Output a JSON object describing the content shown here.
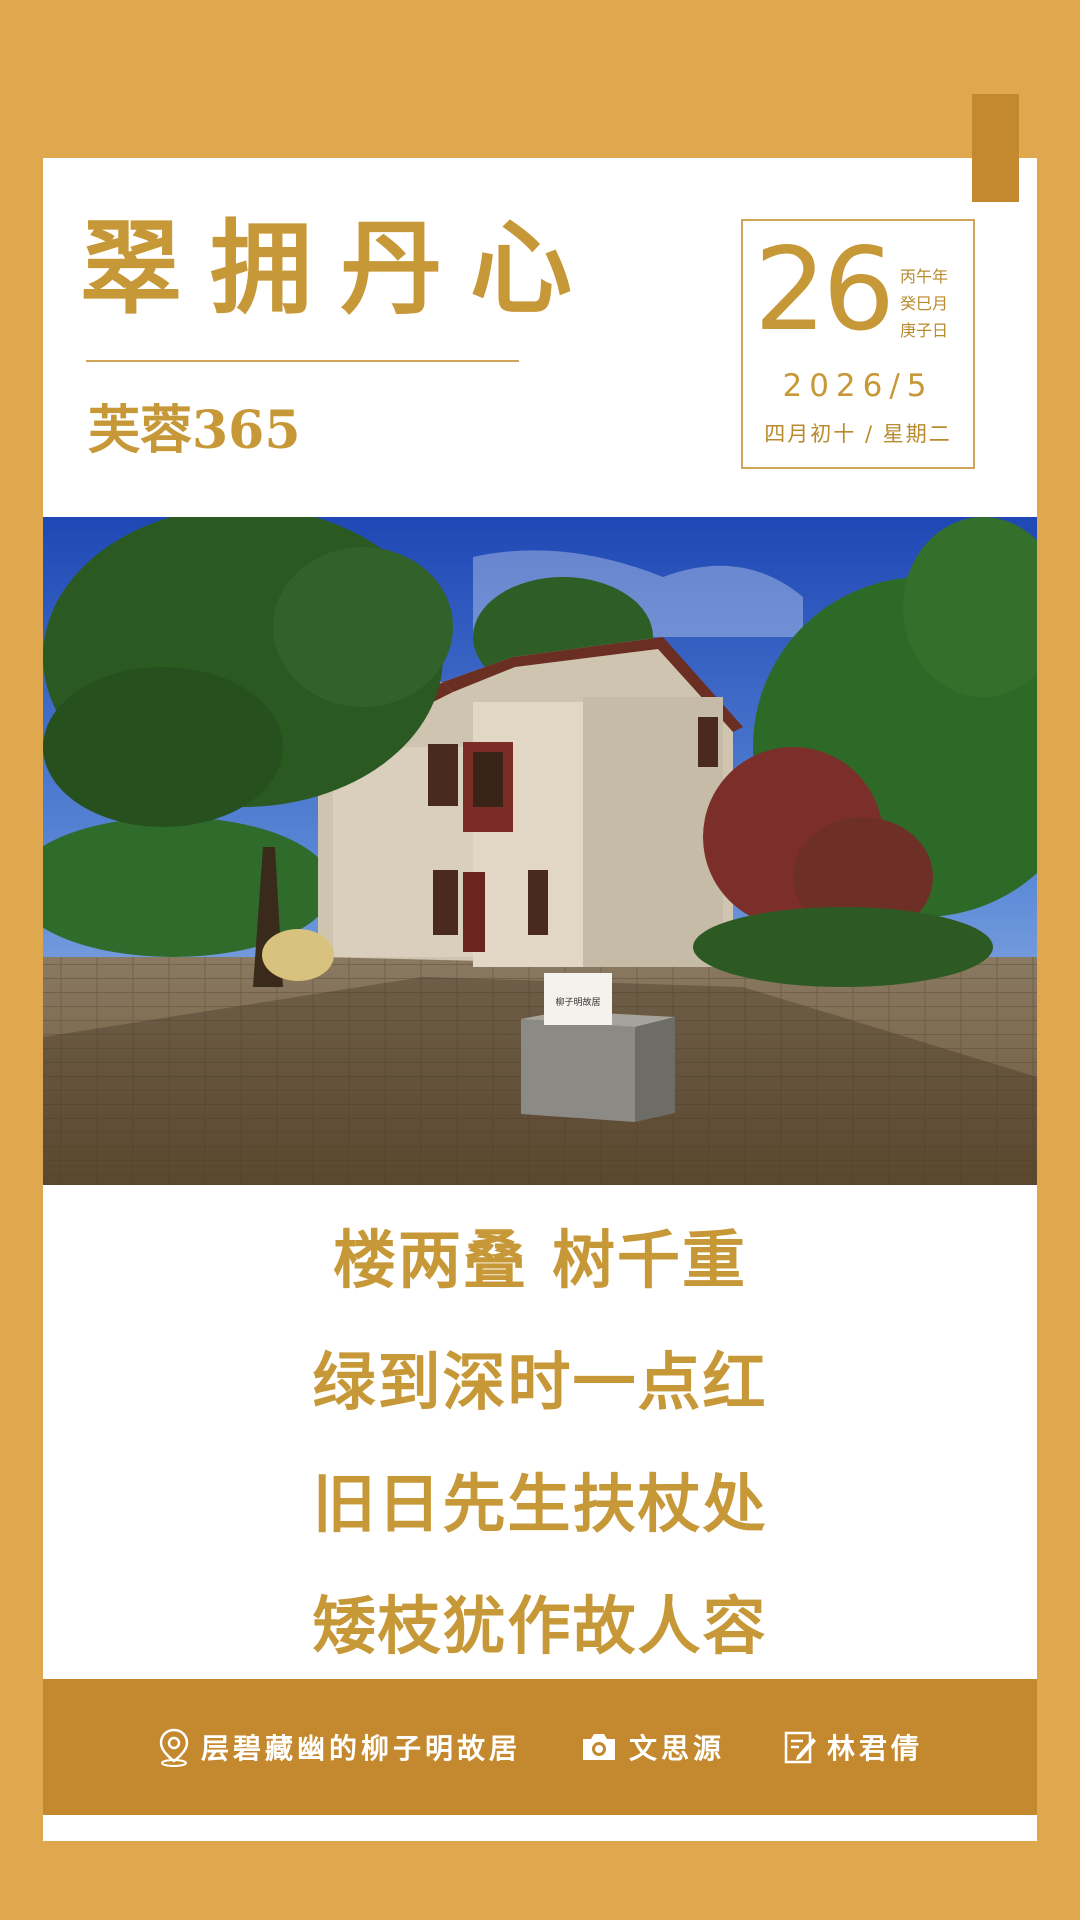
{
  "header": {
    "title": "翠拥丹心",
    "subtitle": "芙蓉365"
  },
  "calendar": {
    "day": "26",
    "ganzhi": [
      "丙午年",
      "癸巳月",
      "庚子日"
    ],
    "year_month": "2026/5",
    "lunar_weekday": "四月初十 / 星期二"
  },
  "photo": {
    "plaque_text": "柳子明故居"
  },
  "poem": {
    "lines": [
      "楼两叠  树千重",
      "绿到深时一点红",
      "旧日先生扶杖处",
      "矮枝犹作故人容"
    ]
  },
  "footer": {
    "location": "层碧藏幽的柳子明故居",
    "photographer": "文思源",
    "author": "林君倩",
    "icons": [
      "location-pin-icon",
      "camera-icon",
      "edit-icon"
    ]
  },
  "colors": {
    "background": "#DFA84F",
    "accent": "#C79838",
    "footer": "#C4892E",
    "card": "#FFFFFF"
  }
}
